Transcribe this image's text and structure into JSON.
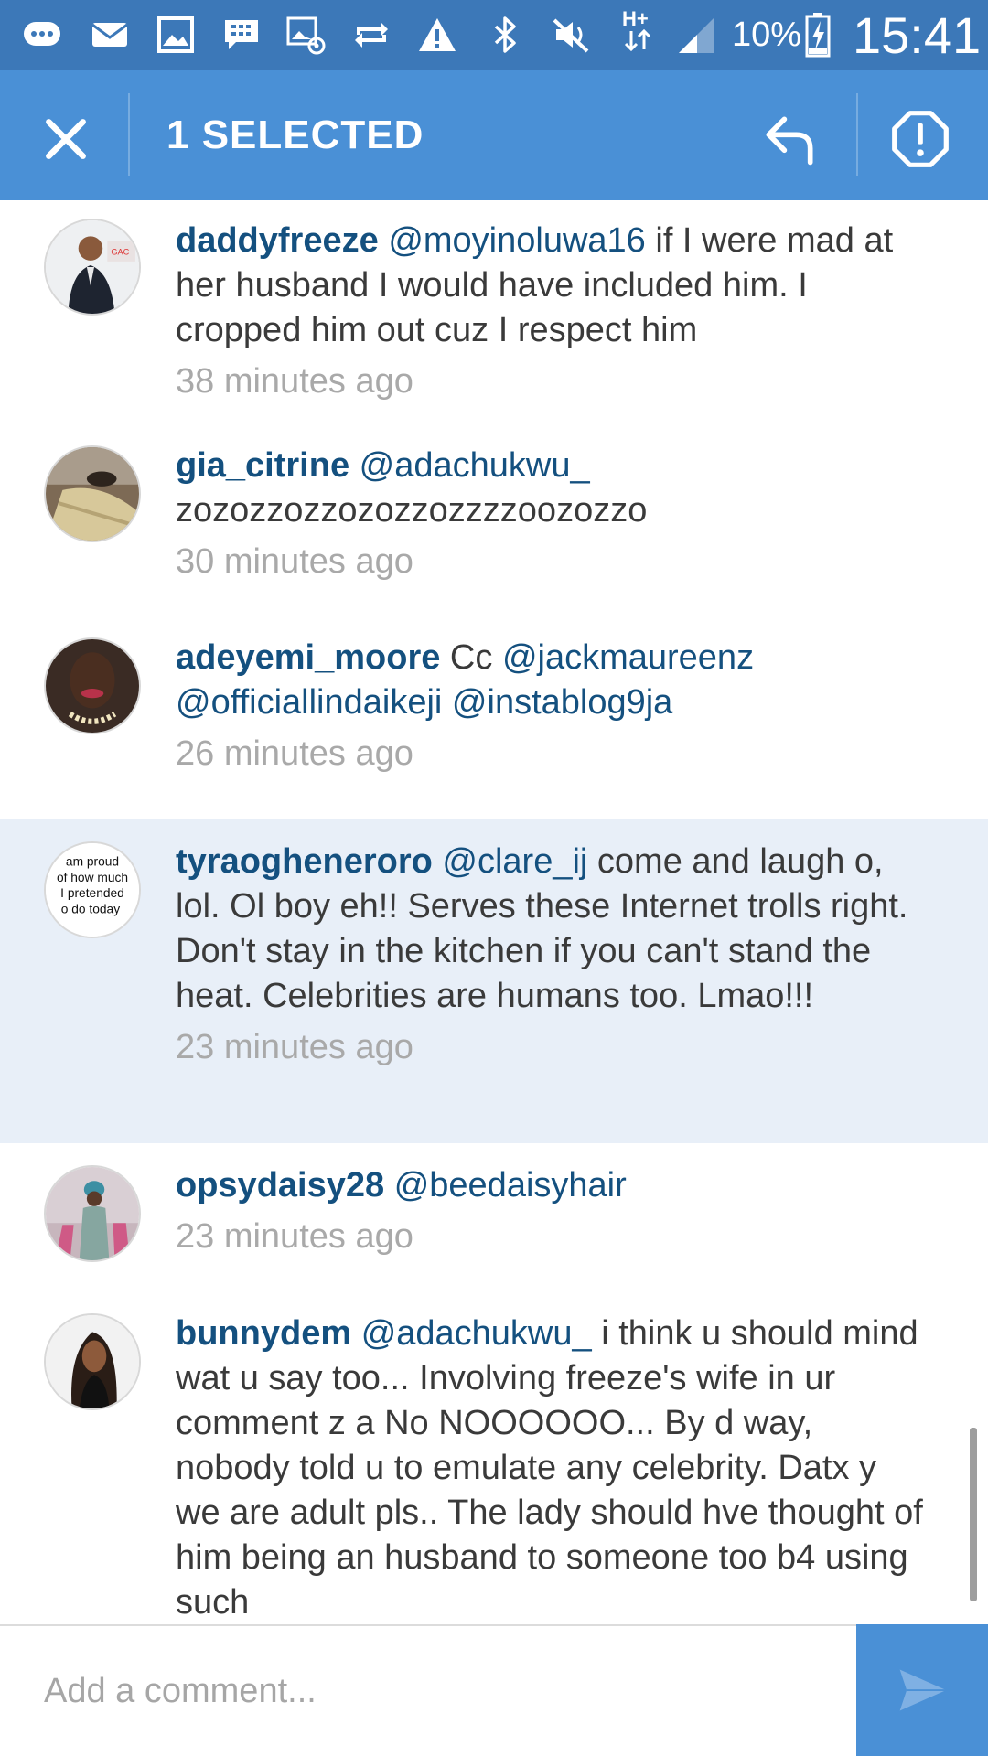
{
  "status_bar": {
    "battery_percent": "10%",
    "time": "15:41",
    "network_type": "H+",
    "icons": [
      "chat-bubble-icon",
      "mail-icon",
      "image-icon",
      "bbm-icon",
      "picture-message-icon",
      "sync-icon",
      "warning-icon",
      "bluetooth-icon",
      "mute-icon",
      "network-icon",
      "signal-icon",
      "battery-charging-icon"
    ]
  },
  "action_bar": {
    "title": "1 SELECTED",
    "close_icon": "close-icon",
    "reply_icon": "reply-icon",
    "report_icon": "report-icon"
  },
  "comments": [
    {
      "username": "daddyfreeze",
      "mention": "@moyinoluwa16",
      "text": " if I were mad at her husband I would have included him. I cropped him out cuz I respect him",
      "time": "38 minutes ago"
    },
    {
      "username": "gia_citrine",
      "mention": "@adachukwu_",
      "text": " zozozzozzozozzozzzzoozozzo",
      "time": "30 minutes ago"
    },
    {
      "username": "adeyemi_moore",
      "text": " Cc ",
      "mentions": [
        "@jackmaureenz",
        "@officiallindaikeji",
        "@instablog9ja"
      ],
      "time": "26 minutes ago"
    },
    {
      "username": "tyraogheneroro",
      "mention": "@clare_ij",
      "text": " come and laugh o, lol. Ol boy eh!! Serves these Internet trolls right. Don't stay in the kitchen if you can't stand the heat. Celebrities are humans too. Lmao!!!",
      "time": "23 minutes ago",
      "avatar_text": [
        "am proud",
        "of how much",
        "I pretended",
        "o do today"
      ],
      "selected": true
    },
    {
      "username": "opsydaisy28",
      "mention": "@beedaisyhair",
      "text": "",
      "time": "23 minutes ago"
    },
    {
      "username": "bunnydem",
      "mention": "@adachukwu_",
      "text": " i think u should mind wat u say too... Involving freeze's wife in ur comment z a No NOOOOOO... By d way, nobody told u to emulate any celebrity. Datx y we are adult pls.. The lady should hve thought of him being an husband to someone too b4 using such",
      "time": ""
    }
  ],
  "comment_input": {
    "placeholder": "Add a comment...",
    "send_icon": "send-icon"
  },
  "colors": {
    "status_bar": "#3c78b8",
    "action_bar": "#4a90d6",
    "username": "#14507f",
    "timestamp": "#a9a9a9",
    "selected_row": "#e8eff8"
  }
}
